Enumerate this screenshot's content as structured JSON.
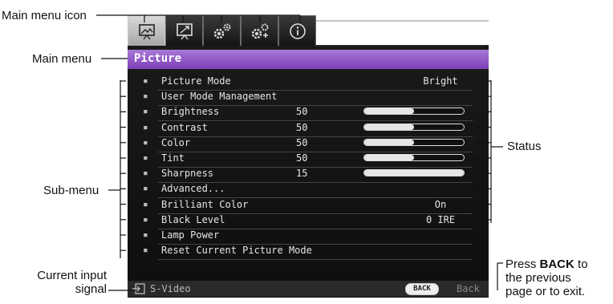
{
  "callouts": {
    "main_menu_icon": "Main menu icon",
    "main_menu": "Main menu",
    "sub_menu": "Sub-menu",
    "current_input_1": "Current input",
    "current_input_2": "signal",
    "status": "Status",
    "press_back_1": "Press",
    "press_back_bold": "BACK",
    "press_back_2": "to",
    "press_back_3": "the previous",
    "press_back_4": "page or to exit."
  },
  "tabs": [
    {
      "icon": "picture-icon",
      "active": true
    },
    {
      "icon": "display-icon",
      "active": false
    },
    {
      "icon": "basic-settings-icon",
      "active": false
    },
    {
      "icon": "advanced-settings-icon",
      "active": false
    },
    {
      "icon": "information-icon",
      "active": false
    }
  ],
  "menu": {
    "title": "Picture",
    "rows": [
      {
        "name": "Picture Mode",
        "value": "",
        "status": "Bright"
      },
      {
        "name": "User Mode Management",
        "value": "",
        "status": ""
      },
      {
        "name": "Brightness",
        "value": "50",
        "slider": 0.5
      },
      {
        "name": "Contrast",
        "value": "50",
        "slider": 0.5
      },
      {
        "name": "Color",
        "value": "50",
        "slider": 0.5
      },
      {
        "name": "Tint",
        "value": "50",
        "slider": 0.5
      },
      {
        "name": "Sharpness",
        "value": "15",
        "slider": 1.0
      },
      {
        "name": "Advanced...",
        "value": "",
        "status": ""
      },
      {
        "name": "Brilliant Color",
        "value": "",
        "status": "On"
      },
      {
        "name": "Black Level",
        "value": "",
        "status": "0 IRE"
      },
      {
        "name": "Lamp Power",
        "value": "",
        "status": ""
      },
      {
        "name": "Reset Current Picture Mode",
        "value": "",
        "status": ""
      }
    ]
  },
  "bottom": {
    "input": "S-Video",
    "back_button": "BACK",
    "back_text": "Back"
  },
  "colors": {
    "title_bar": "#7d3fb6",
    "osd_background": "#141414"
  }
}
